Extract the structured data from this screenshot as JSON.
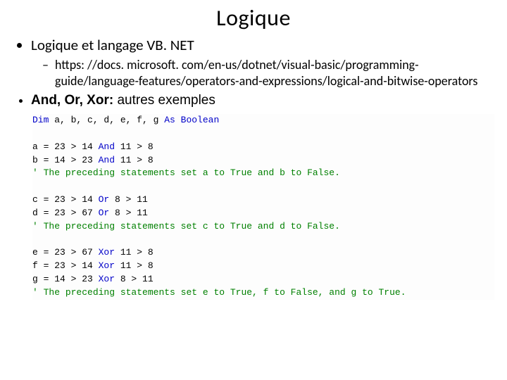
{
  "title": "Logique",
  "bullet1": "Logique et langage VB. NET",
  "link": "https: //docs. microsoft. com/en-us/dotnet/visual-basic/programming-guide/language-features/operators-and-expressions/logical-and-bitwise-operators",
  "bullet2_bold": "And, Or, Xor:",
  "bullet2_rest": " autres exemples",
  "code": {
    "l1": {
      "kw1": "Dim",
      "mid": " a, b, c, d, e, f, g ",
      "kw2": "As Boolean"
    },
    "l2": "",
    "l3": {
      "a": "a = 23 > 14 ",
      "kw": "And",
      "b": " 11 > 8"
    },
    "l4": {
      "a": "b = 14 > 23 ",
      "kw": "And",
      "b": " 11 > 8"
    },
    "l5": {
      "tick": "'",
      "c": " The preceding statements set a to True and b to False."
    },
    "l6": "",
    "l7": {
      "a": "c = 23 > 14 ",
      "kw": "Or",
      "b": " 8 > 11"
    },
    "l8": {
      "a": "d = 23 > 67 ",
      "kw": "Or",
      "b": " 8 > 11"
    },
    "l9": {
      "tick": "'",
      "c": " The preceding statements set c to True and d to False."
    },
    "l10": "",
    "l11": {
      "a": "e = 23 > 67 ",
      "kw": "Xor",
      "b": " 11 > 8"
    },
    "l12": {
      "a": "f = 23 > 14 ",
      "kw": "Xor",
      "b": " 11 > 8"
    },
    "l13": {
      "a": "g = 14 > 23 ",
      "kw": "Xor",
      "b": " 8 > 11"
    },
    "l14": {
      "tick": "'",
      "c": " The preceding statements set e to True, f to False, and g to True."
    }
  }
}
